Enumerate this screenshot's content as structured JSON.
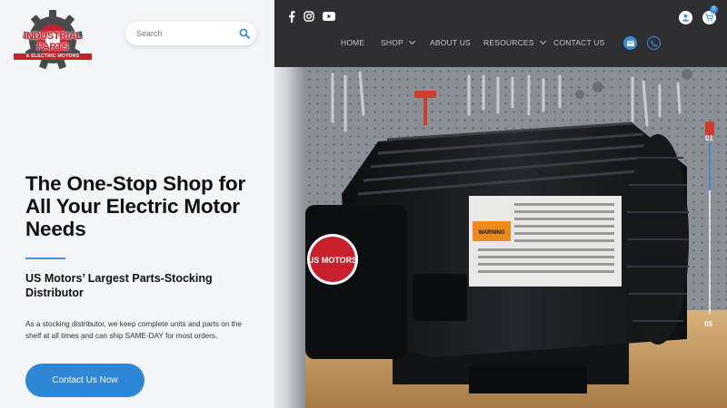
{
  "brand": {
    "name": "INDUSTRIAL PARTS",
    "tagline": "& ELECTRIC MOTORS"
  },
  "search": {
    "placeholder": "Search"
  },
  "social": [
    "facebook-icon",
    "instagram-icon",
    "youtube-icon"
  ],
  "nav": {
    "items": [
      {
        "label": "HOME",
        "dropdown": false
      },
      {
        "label": "SHOP",
        "dropdown": true
      },
      {
        "label": "ABOUT US",
        "dropdown": false
      },
      {
        "label": "RESOURCES",
        "dropdown": true
      },
      {
        "label": "CONTACT US",
        "dropdown": false
      }
    ]
  },
  "cart": {
    "count": "0"
  },
  "hero": {
    "headline": "The One-Stop Shop for All Your Electric Motor Needs",
    "subhead": "US Motors’ Largest Parts-Stocking Distributor",
    "body": "As a stocking distributor, we keep complete units and parts on the shelf at all times and can ship SAME-DAY for most orders.",
    "cta_label": "Contact Us Now",
    "motor_logo": "US MOTORS",
    "warning_label": "WARNING"
  },
  "slider": {
    "start": "01",
    "end": "05",
    "progress": 0.27
  },
  "colors": {
    "brand_red": "#c8202c",
    "accent_blue": "#2e86d6",
    "topbar": "#2f2f31",
    "panel": "#f3f5f9"
  }
}
